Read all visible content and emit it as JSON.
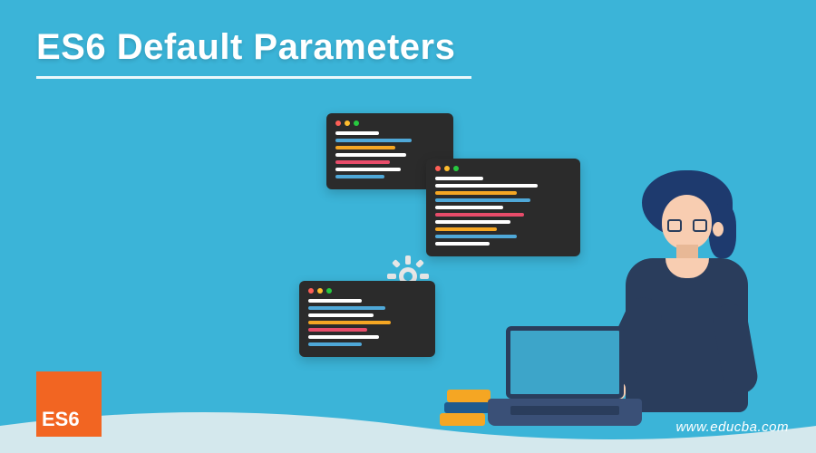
{
  "title": "ES6 Default Parameters",
  "logo_text": "ES6",
  "website": "www.educba.com",
  "colors": {
    "background": "#3bb4d8",
    "logo_bg": "#f26522",
    "code_bg": "#2b2b2b",
    "hair": "#1e3a6e",
    "shirt": "#2a3d5c",
    "skin": "#f8cdb1",
    "laptop": "#3a5077"
  },
  "code_windows": [
    {
      "lines": [
        {
          "color": "#fff",
          "width": "40%"
        },
        {
          "color": "#4fa8d8",
          "width": "70%"
        },
        {
          "color": "#f5a623",
          "width": "55%"
        },
        {
          "color": "#fff",
          "width": "65%"
        },
        {
          "color": "#e84c6a",
          "width": "50%"
        },
        {
          "color": "#fff",
          "width": "60%"
        },
        {
          "color": "#4fa8d8",
          "width": "45%"
        }
      ]
    },
    {
      "lines": [
        {
          "color": "#fff",
          "width": "35%"
        },
        {
          "color": "#fff",
          "width": "75%"
        },
        {
          "color": "#f5a623",
          "width": "60%"
        },
        {
          "color": "#4fa8d8",
          "width": "70%"
        },
        {
          "color": "#fff",
          "width": "50%"
        },
        {
          "color": "#e84c6a",
          "width": "65%"
        },
        {
          "color": "#fff",
          "width": "55%"
        },
        {
          "color": "#f5a623",
          "width": "45%"
        },
        {
          "color": "#4fa8d8",
          "width": "60%"
        },
        {
          "color": "#fff",
          "width": "40%"
        }
      ]
    },
    {
      "lines": [
        {
          "color": "#fff",
          "width": "45%"
        },
        {
          "color": "#4fa8d8",
          "width": "65%"
        },
        {
          "color": "#fff",
          "width": "55%"
        },
        {
          "color": "#f5a623",
          "width": "70%"
        },
        {
          "color": "#e84c6a",
          "width": "50%"
        },
        {
          "color": "#fff",
          "width": "60%"
        },
        {
          "color": "#4fa8d8",
          "width": "45%"
        }
      ]
    }
  ]
}
